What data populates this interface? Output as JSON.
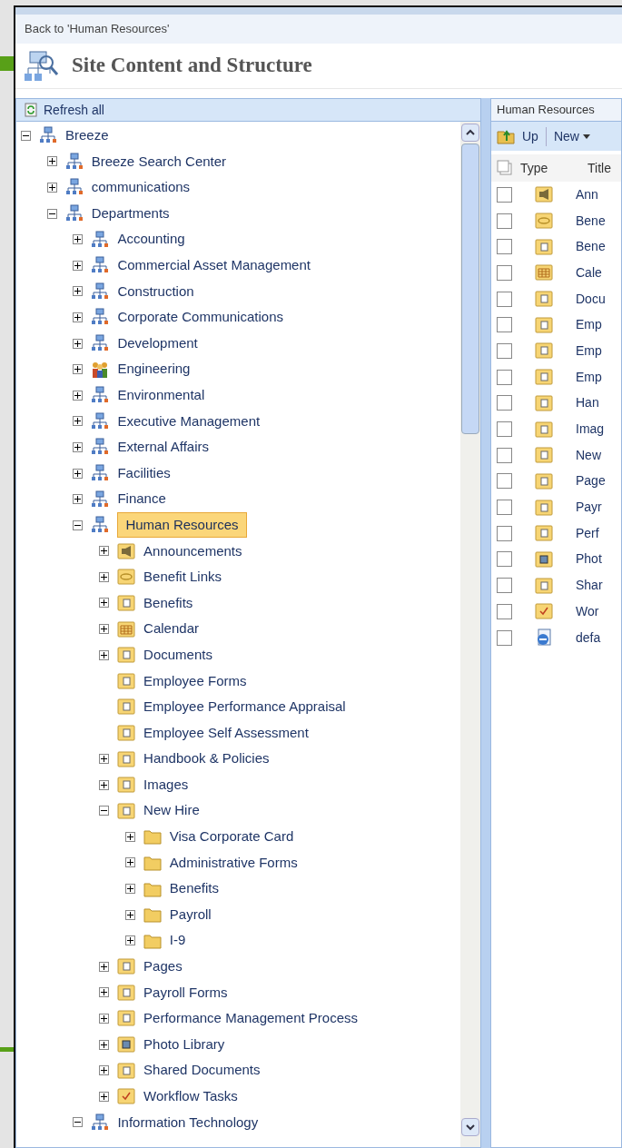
{
  "back_link": "Back to 'Human Resources'",
  "page_title": "Site Content and Structure",
  "tree_panel": {
    "refresh": "Refresh all",
    "tree": [
      {
        "label": "Breeze",
        "kind": "site",
        "expanded": true,
        "selected": false,
        "children": [
          {
            "label": "Breeze Search Center",
            "kind": "site",
            "expanded": false,
            "selected": false
          },
          {
            "label": "communications",
            "kind": "site",
            "expanded": false,
            "selected": false
          },
          {
            "label": "Departments",
            "kind": "site",
            "expanded": true,
            "selected": false,
            "children": [
              {
                "label": "Accounting",
                "kind": "site",
                "expanded": false,
                "selected": false
              },
              {
                "label": "Commercial Asset Management",
                "kind": "site",
                "expanded": false,
                "selected": false
              },
              {
                "label": "Construction",
                "kind": "site",
                "expanded": false,
                "selected": false
              },
              {
                "label": "Corporate Communications",
                "kind": "site",
                "expanded": false,
                "selected": false
              },
              {
                "label": "Development",
                "kind": "site",
                "expanded": false,
                "selected": false
              },
              {
                "label": "Engineering",
                "kind": "team",
                "expanded": false,
                "selected": false
              },
              {
                "label": "Environmental",
                "kind": "site",
                "expanded": false,
                "selected": false
              },
              {
                "label": "Executive Management",
                "kind": "site",
                "expanded": false,
                "selected": false
              },
              {
                "label": "External Affairs",
                "kind": "site",
                "expanded": false,
                "selected": false
              },
              {
                "label": "Facilities",
                "kind": "site",
                "expanded": false,
                "selected": false
              },
              {
                "label": "Finance",
                "kind": "site",
                "expanded": false,
                "selected": false
              },
              {
                "label": "Human Resources",
                "kind": "site",
                "expanded": true,
                "selected": true,
                "children": [
                  {
                    "label": "Announcements",
                    "kind": "announcements",
                    "expanded": false,
                    "selected": false
                  },
                  {
                    "label": "Benefit Links",
                    "kind": "links",
                    "expanded": false,
                    "selected": false
                  },
                  {
                    "label": "Benefits",
                    "kind": "library",
                    "expanded": false,
                    "selected": false
                  },
                  {
                    "label": "Calendar",
                    "kind": "calendar",
                    "expanded": false,
                    "selected": false
                  },
                  {
                    "label": "Documents",
                    "kind": "library",
                    "expanded": false,
                    "selected": false
                  },
                  {
                    "label": "Employee Forms",
                    "kind": "library",
                    "selected": false
                  },
                  {
                    "label": "Employee Performance Appraisal",
                    "kind": "library",
                    "selected": false
                  },
                  {
                    "label": "Employee Self Assessment",
                    "kind": "library",
                    "selected": false
                  },
                  {
                    "label": "Handbook & Policies",
                    "kind": "library",
                    "expanded": false,
                    "selected": false
                  },
                  {
                    "label": "Images",
                    "kind": "library",
                    "expanded": false,
                    "selected": false
                  },
                  {
                    "label": "New Hire",
                    "kind": "library",
                    "expanded": true,
                    "selected": false,
                    "children": [
                      {
                        "label": "Visa Corporate Card",
                        "kind": "folder",
                        "expanded": false,
                        "selected": false
                      },
                      {
                        "label": "Administrative Forms",
                        "kind": "folder",
                        "expanded": false,
                        "selected": false
                      },
                      {
                        "label": "Benefits",
                        "kind": "folder",
                        "expanded": false,
                        "selected": false
                      },
                      {
                        "label": "Payroll",
                        "kind": "folder",
                        "expanded": false,
                        "selected": false
                      },
                      {
                        "label": "I-9",
                        "kind": "folder",
                        "expanded": false,
                        "selected": false
                      }
                    ]
                  },
                  {
                    "label": "Pages",
                    "kind": "library",
                    "expanded": false,
                    "selected": false
                  },
                  {
                    "label": "Payroll Forms",
                    "kind": "library",
                    "expanded": false,
                    "selected": false
                  },
                  {
                    "label": "Performance Management Process",
                    "kind": "library",
                    "expanded": false,
                    "selected": false
                  },
                  {
                    "label": "Photo Library",
                    "kind": "photo",
                    "expanded": false,
                    "selected": false
                  },
                  {
                    "label": "Shared Documents",
                    "kind": "library",
                    "expanded": false,
                    "selected": false
                  },
                  {
                    "label": "Workflow Tasks",
                    "kind": "tasks",
                    "expanded": false,
                    "selected": false
                  }
                ]
              },
              {
                "label": "Information Technology",
                "kind": "site",
                "expanded": true,
                "selected": false
              }
            ]
          }
        ]
      }
    ]
  },
  "list_panel": {
    "breadcrumb": "Human Resources",
    "toolbar": {
      "up": "Up",
      "new": "New"
    },
    "columns": [
      "Type",
      "Title"
    ],
    "rows": [
      {
        "kind": "announcements",
        "title": "Ann",
        "checked": false
      },
      {
        "kind": "links",
        "title": "Bene",
        "checked": false
      },
      {
        "kind": "library",
        "title": "Bene",
        "checked": false
      },
      {
        "kind": "calendar",
        "title": "Cale",
        "checked": false
      },
      {
        "kind": "library",
        "title": "Docu",
        "checked": false
      },
      {
        "kind": "library",
        "title": "Emp",
        "checked": false
      },
      {
        "kind": "library",
        "title": "Emp",
        "checked": false
      },
      {
        "kind": "library",
        "title": "Emp",
        "checked": false
      },
      {
        "kind": "library",
        "title": "Han",
        "checked": false
      },
      {
        "kind": "library",
        "title": "Imag",
        "checked": false
      },
      {
        "kind": "library",
        "title": "New",
        "checked": false
      },
      {
        "kind": "library",
        "title": "Page",
        "checked": false
      },
      {
        "kind": "library",
        "title": "Payr",
        "checked": false
      },
      {
        "kind": "library",
        "title": "Perf",
        "checked": false
      },
      {
        "kind": "photo",
        "title": "Phot",
        "checked": false
      },
      {
        "kind": "library",
        "title": "Shar",
        "checked": false
      },
      {
        "kind": "tasks",
        "title": "Wor",
        "checked": false
      },
      {
        "kind": "page",
        "title": "defa",
        "checked": false
      }
    ]
  }
}
